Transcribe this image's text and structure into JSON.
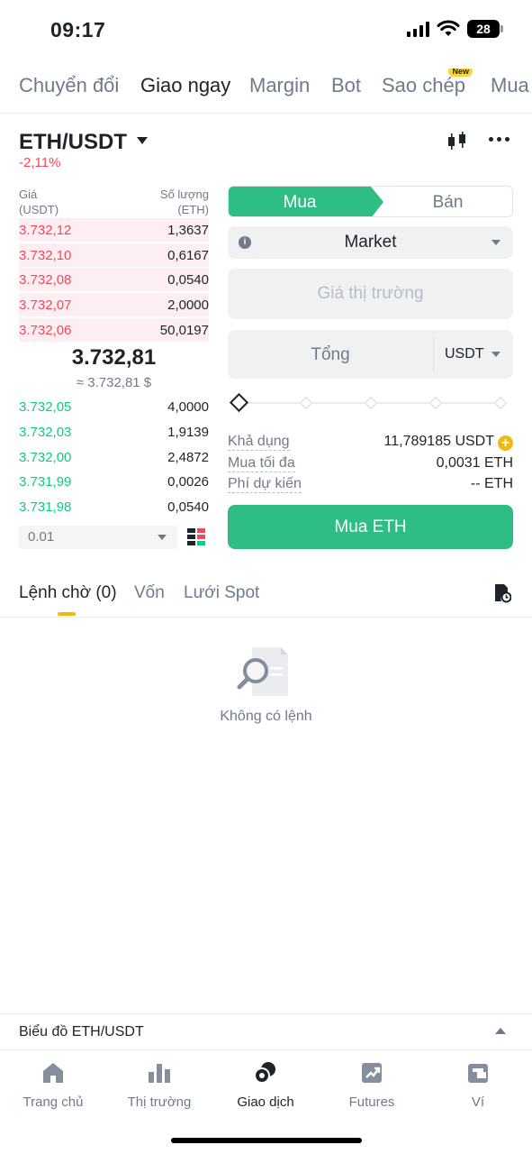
{
  "status_bar": {
    "time": "09:17",
    "battery": "28"
  },
  "top_tabs": [
    {
      "label": "Chuyển đổi"
    },
    {
      "label": "Giao ngay"
    },
    {
      "label": "Margin"
    },
    {
      "label": "Bot"
    },
    {
      "label": "Sao chép",
      "badge": "New"
    },
    {
      "label": "Mua"
    }
  ],
  "pair": {
    "symbol": "ETH/USDT",
    "change": "-2,11%"
  },
  "order_book": {
    "price_header": "Giá\n(USDT)",
    "qty_header": "Số lượng\n(ETH)",
    "asks": [
      {
        "price": "3.732,12",
        "qty": "1,3637"
      },
      {
        "price": "3.732,10",
        "qty": "0,6167"
      },
      {
        "price": "3.732,08",
        "qty": "0,0540"
      },
      {
        "price": "3.732,07",
        "qty": "2,0000"
      },
      {
        "price": "3.732,06",
        "qty": "50,0197"
      }
    ],
    "mid_price": "3.732,81",
    "mid_usd": "≈ 3.732,81 $",
    "bids": [
      {
        "price": "3.732,05",
        "qty": "4,0000"
      },
      {
        "price": "3.732,03",
        "qty": "1,9139"
      },
      {
        "price": "3.732,00",
        "qty": "2,4872"
      },
      {
        "price": "3.731,99",
        "qty": "0,0026"
      },
      {
        "price": "3.731,98",
        "qty": "0,0540"
      }
    ],
    "tick_size": "0.01"
  },
  "trade_panel": {
    "buy_label": "Mua",
    "sell_label": "Bán",
    "order_type": "Market",
    "price_placeholder": "Giá thị trường",
    "total_label": "Tổng",
    "total_unit": "USDT",
    "available_label": "Khả dụng",
    "available_value": "11,789185 USDT",
    "max_buy_label": "Mua tối đa",
    "max_buy_value": "0,0031 ETH",
    "fee_label": "Phí dự kiến",
    "fee_value": "-- ETH",
    "submit_label": "Mua ETH"
  },
  "order_tabs": [
    {
      "label": "Lệnh chờ (0)"
    },
    {
      "label": "Vốn"
    },
    {
      "label": "Lưới Spot"
    }
  ],
  "empty_state": {
    "text": "Không có lệnh"
  },
  "chart_bar": {
    "label": "Biểu đồ ETH/USDT"
  },
  "bottom_nav": [
    {
      "label": "Trang chủ",
      "icon": "home-icon"
    },
    {
      "label": "Thị trường",
      "icon": "markets-icon"
    },
    {
      "label": "Giao dịch",
      "icon": "trade-icon"
    },
    {
      "label": "Futures",
      "icon": "futures-icon"
    },
    {
      "label": "Ví",
      "icon": "wallet-icon"
    }
  ],
  "colors": {
    "buy": "#2ebd85",
    "sell": "#f6465d",
    "accent": "#f0b90b"
  }
}
